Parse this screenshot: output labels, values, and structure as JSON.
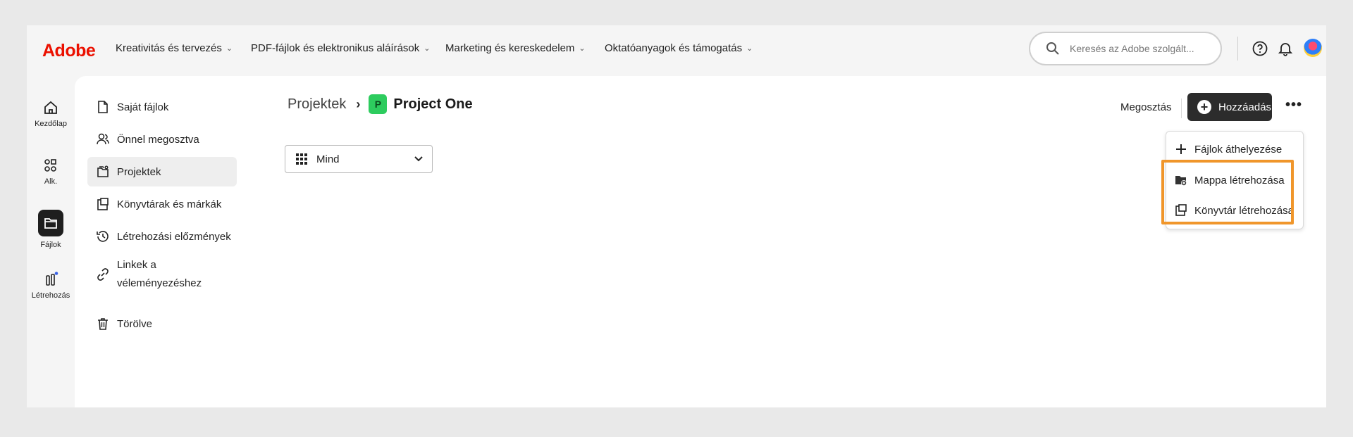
{
  "brand": {
    "logo_text": "Adobe",
    "logo_color": "#eb1000"
  },
  "nav": {
    "items": [
      {
        "label": "Kreativitás és tervezés"
      },
      {
        "label": "PDF-fájlok és elektronikus aláírások"
      },
      {
        "label": "Marketing és kereskedelem"
      },
      {
        "label": "Oktatóanyagok és támogatás"
      }
    ]
  },
  "search": {
    "placeholder": "Keresés az Adobe szolgált..."
  },
  "header_icons": [
    "help-icon",
    "bell-icon",
    "avatar"
  ],
  "rail": {
    "items": [
      {
        "label": "Kezdőlap",
        "icon": "home-icon"
      },
      {
        "label": "Alk.",
        "icon": "apps-icon"
      },
      {
        "label": "Fájlok",
        "icon": "folder-icon",
        "active": true
      },
      {
        "label": "Létrehozás",
        "icon": "create-icon"
      }
    ]
  },
  "sidebar": {
    "items": [
      {
        "label": "Saját fájlok",
        "icon": "file-icon"
      },
      {
        "label": "Önnel megosztva",
        "icon": "shared-users-icon"
      },
      {
        "label": "Projektek",
        "icon": "projects-icon",
        "active": true
      },
      {
        "label": "Könyvtárak és márkák",
        "icon": "library-icon"
      },
      {
        "label": "Létrehozási előzmények",
        "icon": "history-icon"
      },
      {
        "label_line1": "Linkek a",
        "label_line2": "véleményezéshez",
        "icon": "link-icon"
      },
      {
        "label": "Törölve",
        "icon": "trash-icon"
      }
    ]
  },
  "breadcrumb": {
    "parent": "Projektek",
    "separator": "›",
    "badge_letter": "P",
    "badge_color": "#2dcc5e",
    "current": "Project One"
  },
  "filter": {
    "value": "Mind"
  },
  "toolbar": {
    "share_label": "Megosztás",
    "add_label": "Hozzáadás",
    "more_label": "•••"
  },
  "add_menu": {
    "items": [
      {
        "label": "Fájlok áthelyezése",
        "icon": "plus-icon"
      },
      {
        "label": "Mappa létrehozása",
        "icon": "create-folder-icon"
      },
      {
        "label": "Könyvtár létrehozása",
        "icon": "create-library-icon"
      }
    ],
    "highlight_color": "#f0962b"
  }
}
